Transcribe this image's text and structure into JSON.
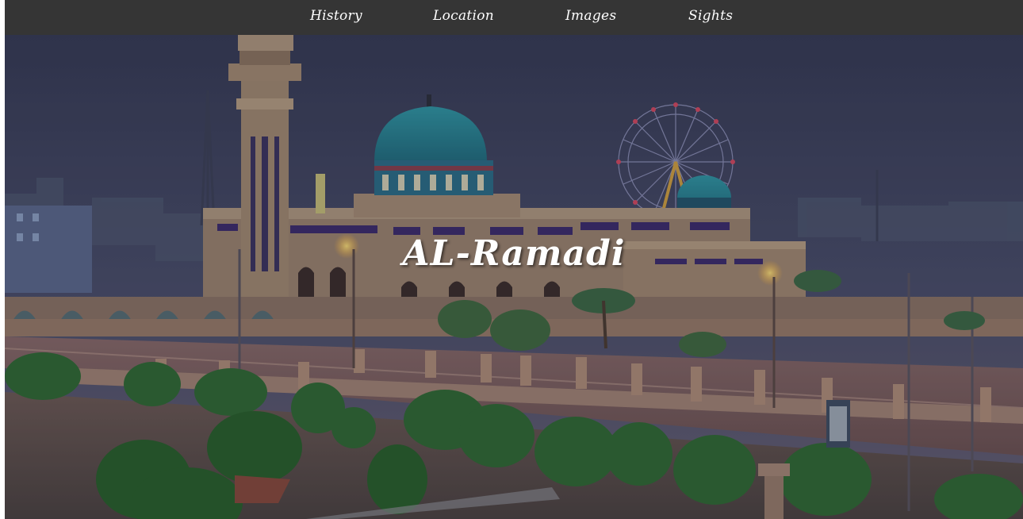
{
  "nav": {
    "links": [
      {
        "label": "History"
      },
      {
        "label": "Location"
      },
      {
        "label": "Images"
      },
      {
        "label": "Sights"
      }
    ]
  },
  "hero": {
    "title": "AL-Ramadi"
  },
  "colors": {
    "navbar_bg": "#353535",
    "nav_text": "#ffffff",
    "title_text": "#ffffff",
    "sky_top": "#3b4060",
    "dome": "#2a8a9a"
  }
}
